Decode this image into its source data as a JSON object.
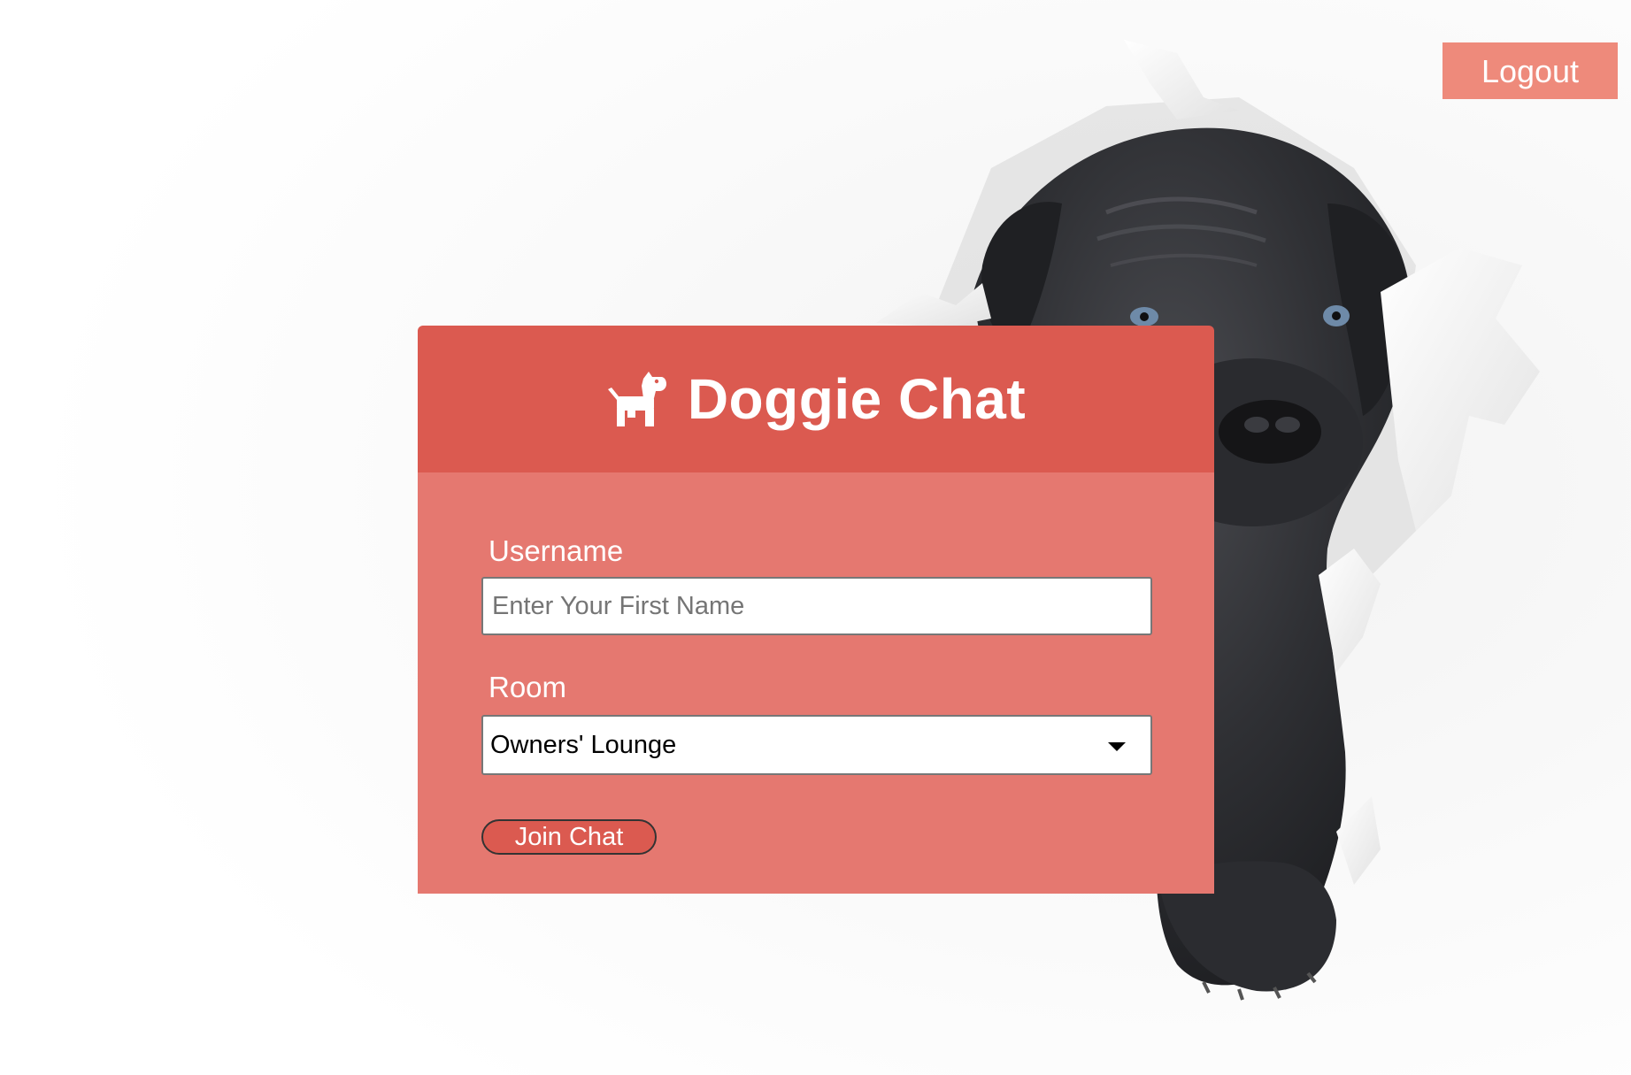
{
  "header": {
    "logout_label": "Logout"
  },
  "card": {
    "title": "Doggie Chat",
    "logo_icon": "dog-icon",
    "username": {
      "label": "Username",
      "placeholder": "Enter Your First Name",
      "value": ""
    },
    "room": {
      "label": "Room",
      "selected": "Owners' Lounge"
    },
    "join_label": "Join Chat"
  },
  "colors": {
    "header_red": "#db5a50",
    "body_salmon": "#e57870",
    "logout_salmon": "#ee8a7b",
    "text_white": "#ffffff"
  }
}
